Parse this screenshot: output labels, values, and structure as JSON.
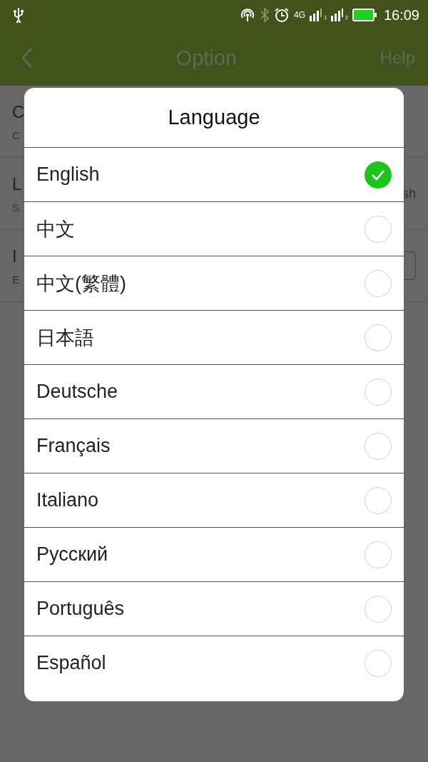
{
  "status_bar": {
    "network": "4G",
    "sim_1": "1",
    "sim_2": "2",
    "time": "16:09"
  },
  "header": {
    "title": "Option",
    "action": "Help"
  },
  "background_rows": [
    {
      "title": "C",
      "subtitle": "C",
      "kind": "plain"
    },
    {
      "title": "L",
      "subtitle": "S",
      "value": "sh",
      "kind": "value"
    },
    {
      "title": "I",
      "subtitle": "E",
      "kind": "toggle",
      "on": false
    }
  ],
  "dialog": {
    "title": "Language",
    "options": [
      {
        "label": "English",
        "selected": true
      },
      {
        "label": "中文",
        "selected": false
      },
      {
        "label": "中文(繁體)",
        "selected": false
      },
      {
        "label": "日本語",
        "selected": false
      },
      {
        "label": "Deutsche",
        "selected": false
      },
      {
        "label": "Français",
        "selected": false
      },
      {
        "label": "Italiano",
        "selected": false
      },
      {
        "label": "Русский",
        "selected": false
      },
      {
        "label": "Português",
        "selected": false
      },
      {
        "label": "Español",
        "selected": false
      }
    ]
  }
}
